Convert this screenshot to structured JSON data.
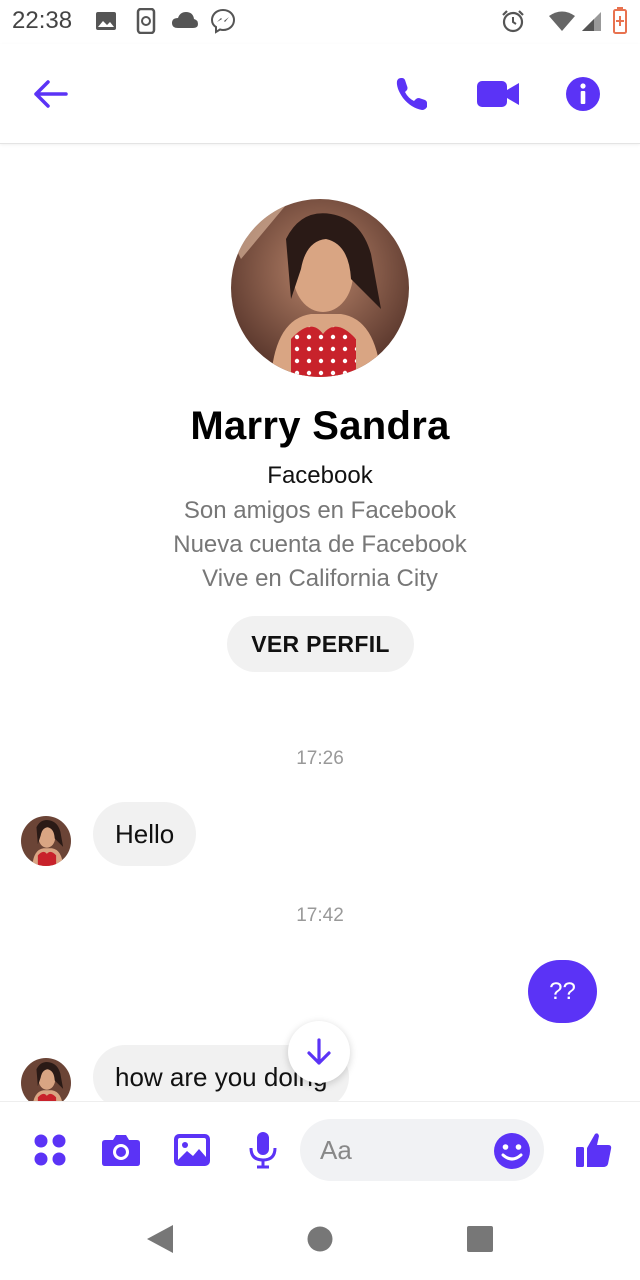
{
  "status_bar": {
    "time": "22:38",
    "left_icons": [
      "image-icon",
      "phone-sync-icon",
      "cloud-icon",
      "messenger-icon"
    ],
    "right_icons": [
      "alarm-icon",
      "wifi-icon",
      "signal-icon",
      "battery-icon"
    ]
  },
  "header": {
    "back_icon": "arrow-left-icon",
    "actions": [
      "phone-icon",
      "video-camera-icon",
      "info-icon"
    ]
  },
  "profile": {
    "name": "Marry Sandra",
    "platform": "Facebook",
    "lines": [
      "Son amigos en Facebook",
      "Nueva cuenta de Facebook",
      "Vive en California City"
    ],
    "view_profile_label": "VER PERFIL"
  },
  "conversation": {
    "timestamp_1": "17:26",
    "message_1": "Hello",
    "timestamp_2": "17:42",
    "message_2": "??",
    "message_3": "how are you doing"
  },
  "composer": {
    "placeholder": "Aa",
    "icons": [
      "apps-icon",
      "camera-icon",
      "gallery-icon",
      "microphone-icon",
      "emoji-icon",
      "thumbs-up-icon"
    ]
  },
  "nav_bar": {
    "icons": [
      "back-triangle-icon",
      "home-circle-icon",
      "recents-square-icon"
    ]
  },
  "colors": {
    "accent": "#5b33f6",
    "bubble_incoming": "#f1f1f1",
    "secondary_text": "#777777"
  }
}
